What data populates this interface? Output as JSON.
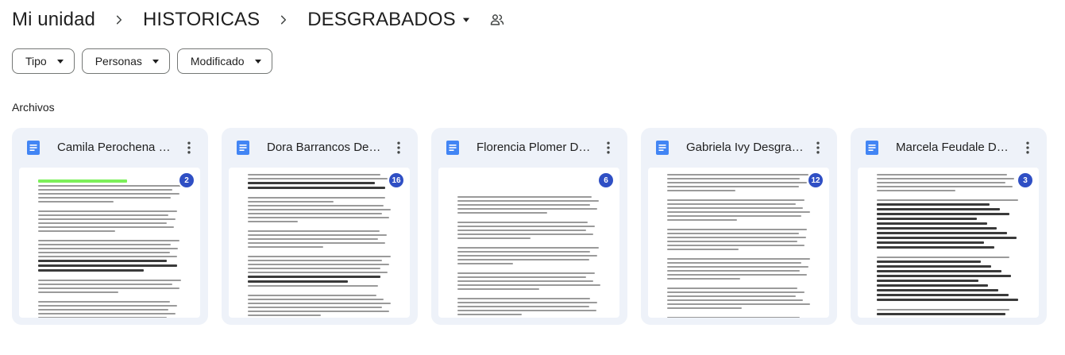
{
  "breadcrumb": {
    "items": [
      "Mi unidad",
      "HISTORICAS"
    ],
    "current": "DESGRABADOS"
  },
  "filters": [
    {
      "label": "Tipo"
    },
    {
      "label": "Personas"
    },
    {
      "label": "Modificado"
    }
  ],
  "section": {
    "label": "Archivos"
  },
  "files": [
    {
      "title": "Camila Perochena Desgrabado",
      "comments": "2"
    },
    {
      "title": "Dora Barrancos Desgrabado",
      "comments": "16"
    },
    {
      "title": "Florencia Plomer Desgrabado",
      "comments": "6"
    },
    {
      "title": "Gabriela Ivy Desgrabado",
      "comments": "12"
    },
    {
      "title": "Marcela Feudale Desgrabado",
      "comments": "3"
    }
  ],
  "colors": {
    "doc_icon": "#4285f4",
    "badge": "#2f4fc4",
    "card_bg": "#eef2f9"
  },
  "icons": {
    "separator": "chevron-right-icon",
    "current_menu": "caret-down-icon",
    "shared": "shared-folder-icon",
    "file_type": "google-doc-icon",
    "file_menu": "more-vert-icon"
  }
}
